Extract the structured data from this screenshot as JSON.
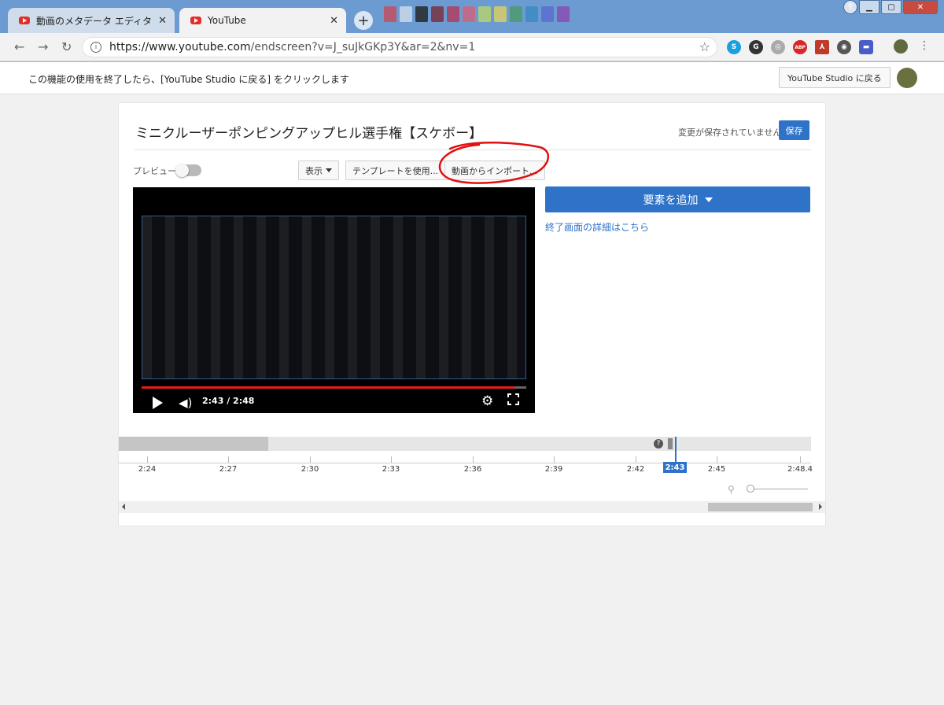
{
  "browser": {
    "tabs": [
      {
        "title": "動画のメタデータ エディタ - Yo",
        "active": false
      },
      {
        "title": "YouTube",
        "active": true
      }
    ],
    "url_host": "https://www.youtube.com",
    "url_path": "/endscreen?v=J_suJkGKp3Y&ar=2&nv=1",
    "extensions": [
      {
        "icon": "skype-icon",
        "color": "#1a9fe0",
        "label": "S"
      },
      {
        "icon": "grammar-icon",
        "color": "#333333",
        "label": "G"
      },
      {
        "icon": "shield-icon",
        "color": "#aaaaaa",
        "label": "◎"
      },
      {
        "icon": "adblock-icon",
        "color": "#d62828",
        "label": "ABP"
      },
      {
        "icon": "pdf-icon",
        "color": "#c0392b",
        "label": "⅄"
      },
      {
        "icon": "eye-icon",
        "color": "#555555",
        "label": "◉"
      },
      {
        "icon": "chat-icon",
        "color": "#4a5cc8",
        "label": "▬"
      }
    ]
  },
  "notice": {
    "text": "この機能の使用を終了したら、[YouTube Studio に戻る] をクリックします",
    "back_button": "YouTube Studio に戻る"
  },
  "editor": {
    "video_title": "ミニクルーザーポンピングアップヒル選手権【スケボー】",
    "unsaved_text": "変更が保存されていません",
    "save_button": "保存",
    "preview_label": "プレビュー",
    "preview_enabled": false,
    "show_button": "表示",
    "template_button": "テンプレートを使用...",
    "import_button": "動画からインポート...",
    "add_element_button": "要素を追加",
    "details_link": "終了画面の詳細はこちら"
  },
  "player": {
    "time": "2:43 / 2:48",
    "progress": 0.97
  },
  "timeline": {
    "ticks": [
      "2:24",
      "2:27",
      "2:30",
      "2:33",
      "2:36",
      "2:39",
      "2:42",
      "2:45",
      "2:48.4"
    ],
    "playhead": "2:43",
    "help": "?"
  },
  "colors": {
    "accent": "#2f73c9",
    "progress_red": "#e21e1e",
    "annotation_red": "#e01010"
  }
}
